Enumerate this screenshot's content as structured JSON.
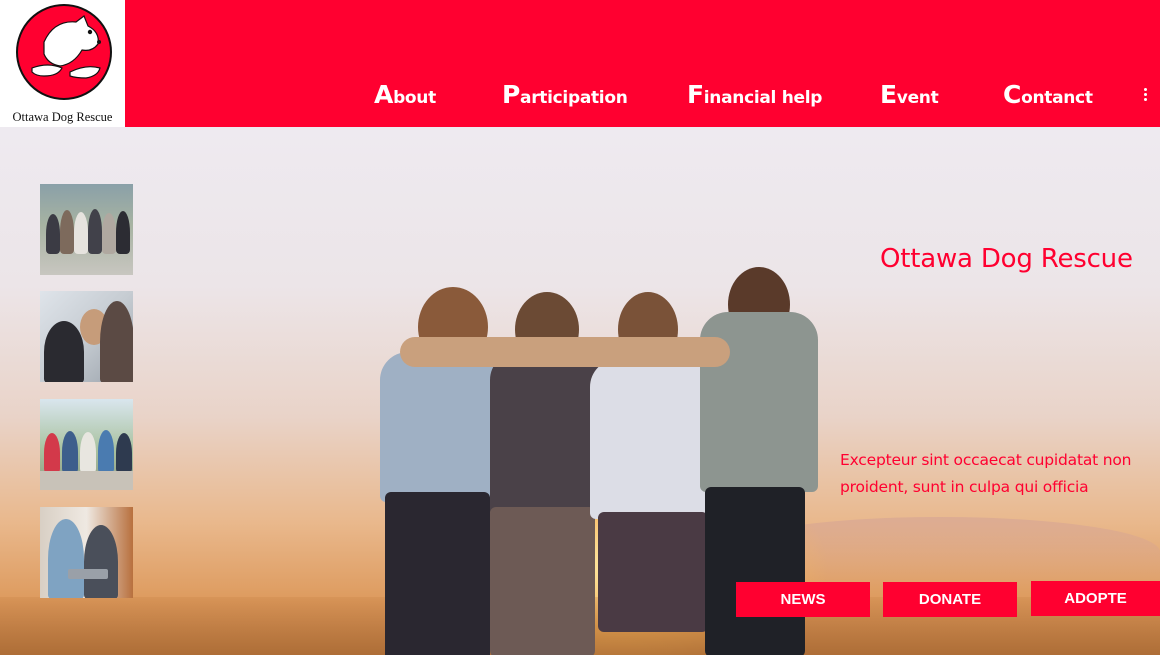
{
  "colors": {
    "brand": "#ff0030",
    "logo_dark": "#111111"
  },
  "logo": {
    "text": "Ottawa Dog Rescue",
    "icon": "dog-hands-logo-icon"
  },
  "nav": {
    "items": [
      {
        "label": "About"
      },
      {
        "label": "Participation"
      },
      {
        "label": "Financial help"
      },
      {
        "label": "Event"
      },
      {
        "label": "Contanct"
      }
    ],
    "menu_icon": "more-vertical-icon"
  },
  "hero": {
    "title": "Ottawa Dog Rescue",
    "text": "Excepteur sint occaecat cupidatat non proident, sunt in culpa qui officia",
    "image": "friends-sunset-photo"
  },
  "thumbnails": [
    {
      "name": "group-photo"
    },
    {
      "name": "people-laughing-photo"
    },
    {
      "name": "friends-sitting-photo"
    },
    {
      "name": "laptop-meeting-photo"
    }
  ],
  "buttons": {
    "news": "NEWS",
    "donate": "DONATE",
    "adopte": "ADOPTE"
  }
}
